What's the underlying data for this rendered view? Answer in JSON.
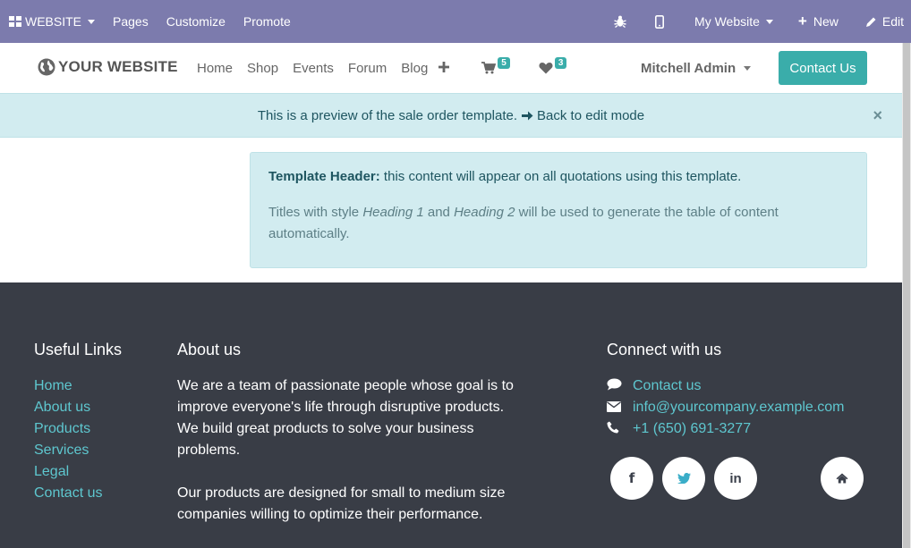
{
  "admin_bar": {
    "website_menu": "WEBSITE",
    "pages": "Pages",
    "customize": "Customize",
    "promote": "Promote",
    "my_website": "My Website",
    "new": "New",
    "edit": "Edit"
  },
  "navbar": {
    "logo": "YOUR WEBSITE",
    "links": [
      "Home",
      "Shop",
      "Events",
      "Forum",
      "Blog"
    ],
    "cart_count": "5",
    "wishlist_count": "3",
    "user": "Mitchell Admin",
    "contact_button": "Contact Us"
  },
  "preview_alert": {
    "text": "This is a preview of the sale order template.",
    "link": "Back to edit mode",
    "close": "×"
  },
  "template_box": {
    "header_bold": "Template Header:",
    "header_text": " this content will appear on all quotations using this template.",
    "p2_a": "Titles with style ",
    "p2_h1": "Heading 1",
    "p2_b": " and ",
    "p2_h2": "Heading 2",
    "p2_c": " will be used to generate the table of content automatically."
  },
  "footer": {
    "useful_links_title": "Useful Links",
    "useful_links": [
      "Home",
      "About us",
      "Products",
      "Services",
      "Legal",
      "Contact us"
    ],
    "about_title": "About us",
    "about_p1": "We are a team of passionate people whose goal is to improve everyone's life through disruptive products. We build great products to solve your business problems.",
    "about_p2": "Our products are designed for small to medium size companies willing to optimize their performance.",
    "connect_title": "Connect with us",
    "contact_link": "Contact us",
    "email": "info@yourcompany.example.com",
    "phone": "+1 (650) 691-3277",
    "social_facebook": "f",
    "social_linkedin": "in"
  },
  "colors": {
    "admin_bar": "#7c7bad",
    "accent": "#3aadaa",
    "alert_bg": "#d2ecf0",
    "footer_bg": "#393d46",
    "footer_link": "#5ec7cf"
  },
  "icons": [
    "grid-icon",
    "bug-icon",
    "mobile-icon",
    "plus-icon",
    "pencil-icon",
    "globe-icon",
    "cart-icon",
    "heart-icon",
    "arrow-right-icon",
    "close-icon",
    "comment-icon",
    "envelope-icon",
    "phone-icon",
    "facebook-icon",
    "twitter-icon",
    "linkedin-icon",
    "home-icon"
  ]
}
